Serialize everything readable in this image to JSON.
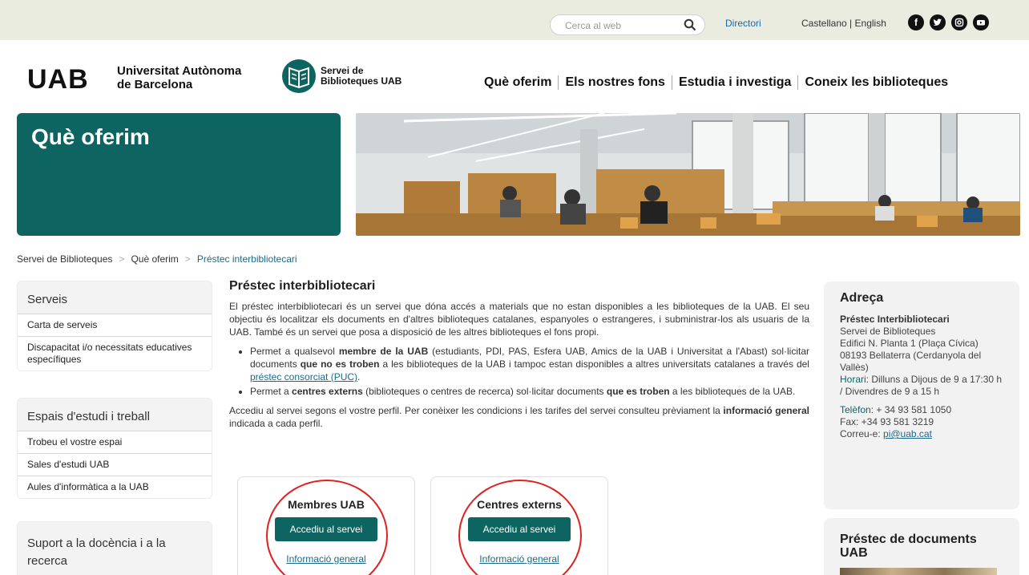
{
  "topbar": {
    "search_placeholder": "Cerca al web",
    "directori": "Directori",
    "lang_es": "Castellano",
    "lang_sep": "|",
    "lang_en": "English",
    "social": [
      "f",
      "t",
      "i",
      "yt"
    ]
  },
  "header": {
    "uab_logo": "UAB",
    "uab_line1": "Universitat Autònoma",
    "uab_line2": "de Barcelona",
    "lib_line1": "Servei de",
    "lib_line2": "Biblioteques UAB",
    "nav": [
      "Què oferim",
      "Els nostres fons",
      "Estudia i investiga",
      "Coneix les biblioteques"
    ]
  },
  "banner": {
    "title": "Què oferim"
  },
  "breadcrumb": [
    "Servei de Biblioteques",
    "Què oferim",
    "Préstec interbibliotecari"
  ],
  "sidebar": [
    {
      "title": "Serveis",
      "items": [
        "Carta de serveis",
        "Discapacitat i/o necessitats educatives específiques"
      ]
    },
    {
      "title": "Espais d'estudi i treball",
      "items": [
        "Trobeu el vostre espai",
        "Sales d'estudi UAB",
        "Aules d'informàtica a la UAB"
      ]
    },
    {
      "title": "Suport a la docència i a la recerca",
      "items": []
    }
  ],
  "main": {
    "title": "Préstec interbibliotecari",
    "intro": "El préstec interbibliotecari és un servei que dóna accés a materials que no estan disponibles a les biblioteques de la UAB. El seu objectiu és localitzar els documents en d'altres biblioteques catalanes, espanyoles o estrangeres, i subministrar-los als usuaris de la UAB. També és un servei que posa a disposició de les altres biblioteques el fons propi.",
    "bullet1_a": "Permet a qualsevol ",
    "bullet1_b": "membre de la UAB",
    "bullet1_c": " (estudiants, PDI, PAS, Esfera UAB, Amics de la UAB i Universitat a l'Abast) sol·licitar documents ",
    "bullet1_d": "que no es troben",
    "bullet1_e": " a les biblioteques de la UAB i tampoc estan disponibles a altres universitats catalanes a través del ",
    "bullet1_link": "préstec consorciat (PUC)",
    "bullet1_f": ".",
    "bullet2_a": "Permet a ",
    "bullet2_b": "centres externs",
    "bullet2_c": " (biblioteques o centres de recerca) sol·licitar documents ",
    "bullet2_d": "que es troben",
    "bullet2_e": " a les biblioteques de la UAB.",
    "access_a": "Accediu al servei segons el vostre perfil. Per conèixer les condicions i les tarifes del servei consulteu prèviament la ",
    "access_b": "informació general",
    "access_c": " indicada a cada perfil.",
    "cards": [
      {
        "title": "Membres UAB",
        "button": "Accediu al servei",
        "link": "Informació general"
      },
      {
        "title": "Centres externs",
        "button": "Accediu al servei",
        "link": "Informació general"
      }
    ]
  },
  "address": {
    "title": "Adreça",
    "name": "Préstec Interbibliotecari",
    "l1": "Servei de Biblioteques",
    "l2": "Edifici N. Planta 1 (Plaça Cívica)",
    "l3": "08193 Bellaterra (Cerdanyola del Vallès)",
    "hours_label": "Horari",
    "hours": ": Dilluns a Dijous de 9 a 17:30 h / Divendres de 9 a 15 h",
    "phone_label": "Telèfon",
    "phone": ": + 34 93 581 1050",
    "fax": "Fax: +34 93 581 3219",
    "email_label": "Correu-e: ",
    "email": "pi@uab.cat"
  },
  "promo": {
    "title": "Préstec de documents UAB"
  }
}
